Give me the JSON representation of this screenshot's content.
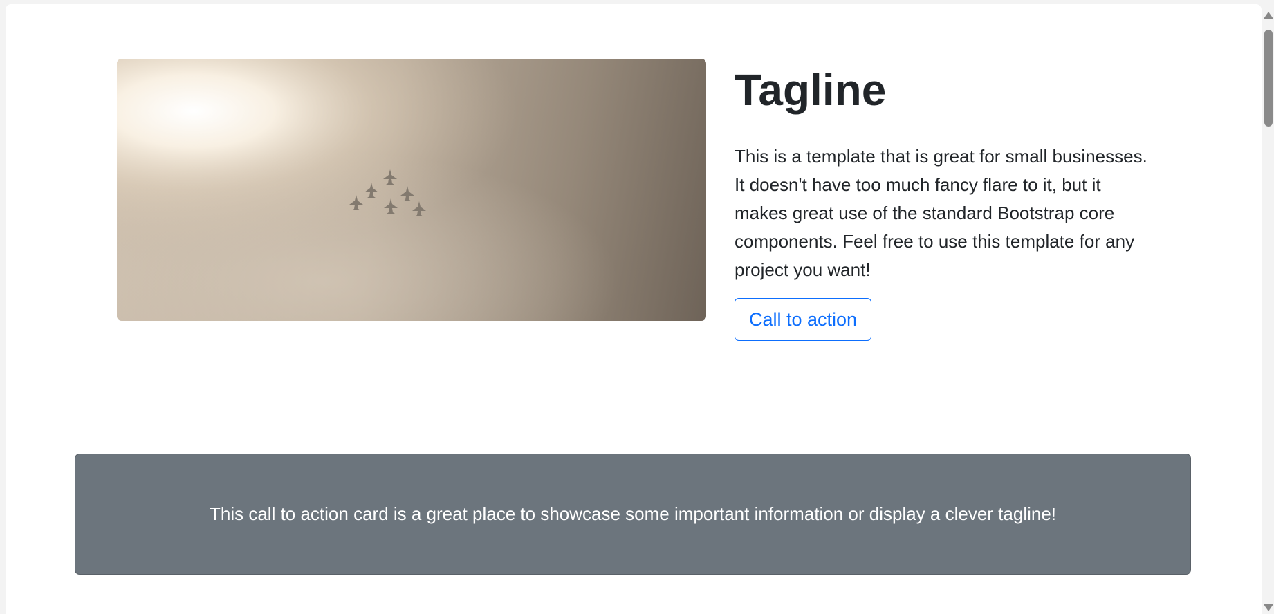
{
  "hero": {
    "image_icon": "fighter-jets-formation-photo",
    "title": "Tagline",
    "lead": "This is a template that is great for small businesses. It doesn't have too much fancy flare to it, but it makes great use of the standard Bootstrap core components. Feel free to use this template for any project you want!",
    "cta_label": "Call to action"
  },
  "cta_card": {
    "text": "This call to action card is a great place to showcase some important information or display a clever tagline!"
  },
  "colors": {
    "primary": "#0d6efd",
    "card_bg": "#6c757d",
    "text": "#212529"
  }
}
